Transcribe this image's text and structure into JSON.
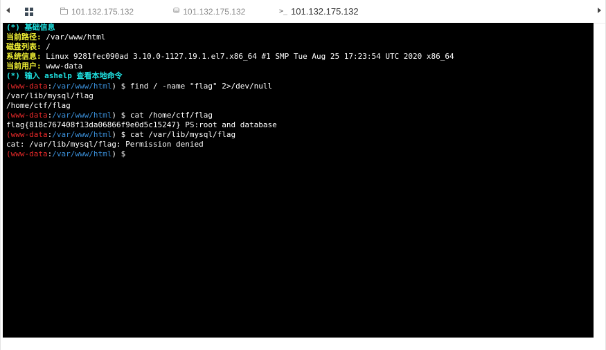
{
  "tabs": [
    {
      "icon": "folder-icon",
      "label": "101.132.175.132"
    },
    {
      "icon": "database-icon",
      "label": "101.132.175.132"
    },
    {
      "icon": "terminal-icon",
      "label": "101.132.175.132",
      "active": true
    }
  ],
  "terminal": {
    "info_header": "(*) 基础信息",
    "info": [
      {
        "label": "当前路径:",
        "value": " /var/www/html"
      },
      {
        "label": "磁盘列表:",
        "value": " /"
      },
      {
        "label": "系统信息:",
        "value": " Linux 9281fec090ad 3.10.0-1127.19.1.el7.x86_64 #1 SMP Tue Aug 25 17:23:54 UTC 2020 x86_64"
      },
      {
        "label": "当前用户:",
        "value": " www-data"
      }
    ],
    "help_hint": "(*) 输入 ashelp 查看本地命令",
    "prompt": {
      "open": "(",
      "user": "www-data",
      "sep": ":",
      "path": "/var/www/html",
      "close": ") $ "
    },
    "commands": [
      {
        "cmd": "find / -name \"flag\" 2>/dev/null",
        "output": [
          "/var/lib/mysql/flag",
          "/home/ctf/flag"
        ]
      },
      {
        "cmd": "cat /home/ctf/flag",
        "output": [
          "flag{818c767408f13da06866f9e0d5c15247} PS:root and database"
        ]
      },
      {
        "cmd": "cat /var/lib/mysql/flag",
        "output": [
          "cat: /var/lib/mysql/flag: Permission denied"
        ]
      }
    ],
    "colors": {
      "background": "#000000",
      "header": "#1fe3e3",
      "label": "#f3f335",
      "user": "#ee2a2a",
      "path": "#3a8fd9",
      "text": "#ffffff"
    }
  }
}
